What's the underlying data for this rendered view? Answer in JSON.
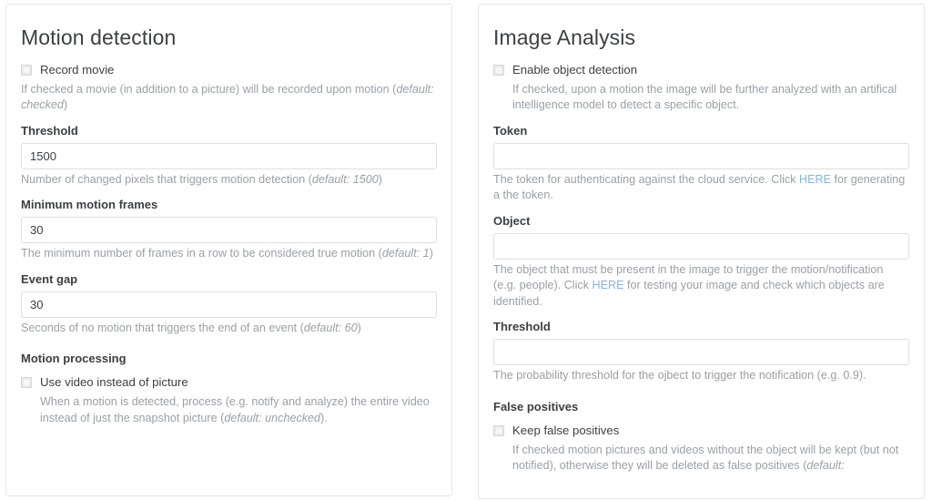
{
  "panels": [
    {
      "id": "motion-detection",
      "title": "Motion detection",
      "record_movie": {
        "label": "Record movie",
        "checked": false,
        "desc_pre": "If checked a movie (in addition to a picture) will be recorded upon motion (",
        "desc_em": "default: checked",
        "desc_post": ")"
      },
      "threshold": {
        "label": "Threshold",
        "value": "1500",
        "placeholder": "",
        "desc_pre": "Number of changed pixels that triggers motion detection (",
        "desc_em": "default: 1500",
        "desc_post": ")"
      },
      "min_motion_frames": {
        "label": "Minimum motion frames",
        "value": "30",
        "placeholder": "",
        "desc_pre": "The minimum number of frames in a row to be considered true motion (",
        "desc_em": "default: 1",
        "desc_post": ")"
      },
      "event_gap": {
        "label": "Event gap",
        "value": "30",
        "placeholder": "",
        "desc_pre": "Seconds of no motion that triggers the end of an event (",
        "desc_em": "default: 60",
        "desc_post": ")"
      },
      "motion_processing": {
        "section_label": "Motion processing",
        "use_video": {
          "label": "Use video instead of picture",
          "checked": false,
          "desc_pre": "When a motion is detected, process (e.g. notify and analyze) the entire video instead of just the snapshot picture (",
          "desc_em": "default: unchecked",
          "desc_post": ")."
        }
      }
    },
    {
      "id": "image-analysis",
      "title": "Image Analysis",
      "enable_object_detection": {
        "label": "Enable object detection",
        "checked": false,
        "desc": "If checked, upon a motion the image will be further analyzed with an artifical intelligence model to detect a specific object."
      },
      "token": {
        "label": "Token",
        "value": "",
        "placeholder": "",
        "desc_pre": "The token for authenticating against the cloud service. Click ",
        "desc_link": "HERE",
        "desc_post": " for generating a the token."
      },
      "object": {
        "label": "Object",
        "value": "",
        "placeholder": "",
        "desc_pre": "The object that must be present in the image to trigger the motion/notification (e.g. people). Click ",
        "desc_link": "HERE",
        "desc_post": " for testing your image and check which objects are identified."
      },
      "threshold": {
        "label": "Threshold",
        "value": "",
        "placeholder": "",
        "desc": "The probability threshold for the ojbect to trigger the notification (e.g. 0.9)."
      },
      "false_positives": {
        "section_label": "False positives",
        "keep_false_positives": {
          "label": "Keep false positives",
          "checked": false,
          "desc_pre": "If checked motion pictures and videos without the object will be kept (but not notified), otherwise they will be deleted as false positives (",
          "desc_em": "default:",
          "desc_post": ""
        }
      }
    }
  ],
  "colors": {
    "link": "#8ab4d8",
    "text": "#3c4043",
    "muted": "#9aa0a6",
    "border": "#e3e6e8",
    "input_border": "#dddfe2"
  }
}
